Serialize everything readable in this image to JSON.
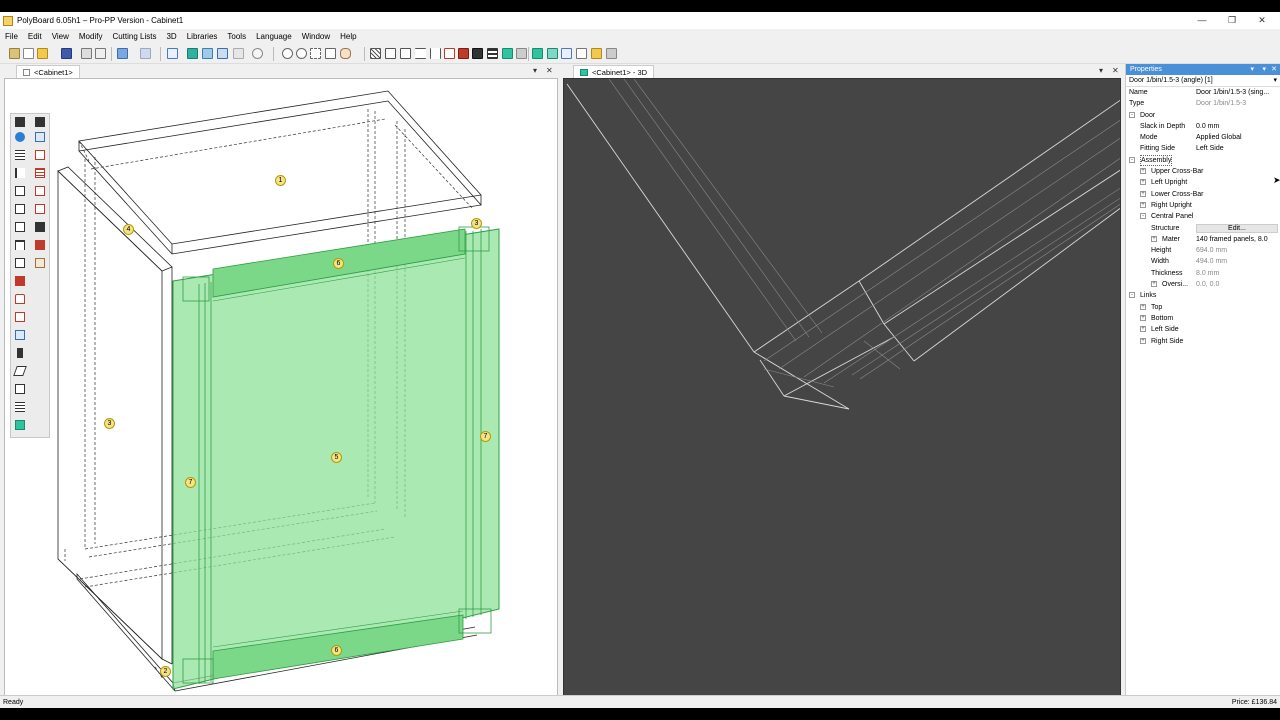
{
  "window": {
    "title": "PolyBoard 6.05h1 – Pro-PP Version - Cabinet1"
  },
  "menu": [
    "File",
    "Edit",
    "View",
    "Modify",
    "Cutting Lists",
    "3D",
    "Libraries",
    "Tools",
    "Language",
    "Window",
    "Help"
  ],
  "tabs": {
    "left": "<Cabinet1>",
    "right": "<Cabinet1> - 3D"
  },
  "parts": {
    "labels": [
      "1",
      "2",
      "3",
      "4",
      "5",
      "6",
      "7"
    ]
  },
  "properties": {
    "header": "Properties",
    "selected": "Door 1/bin/1.5-3 (angle) [1]",
    "rows": {
      "name_label": "Name",
      "name_value": "Door 1/bin/1.5-3 (sing...",
      "type_label": "Type",
      "type_value": "Door 1/bin/1.5-3",
      "door": "Door",
      "slack_label": "Slack in Depth",
      "slack_value": "0.0 mm",
      "mode_label": "Mode",
      "mode_value": "Applied Global",
      "fitting_label": "Fitting Side",
      "fitting_value": "Left Side",
      "assembly": "Assembly",
      "upper_cross_bar": "Upper Cross-Bar",
      "left_upright": "Left Upright",
      "lower_cross_bar": "Lower Cross-Bar",
      "right_upright": "Right Upright",
      "central_panel": "Central Panel",
      "structure_label": "Structure",
      "structure_value": "Edit...",
      "mater_label": "Mater",
      "mater_value": "140 framed panels, 8.0",
      "height_label": "Height",
      "height_value": "694.0 mm",
      "width_label": "Width",
      "width_value": "494.0 mm",
      "thickness_label": "Thickness",
      "thickness_value": "8.0 mm",
      "oversize_label": "Oversi...",
      "oversize_value": "0.0, 0.0",
      "links": "Links",
      "top": "Top",
      "bottom": "Bottom",
      "left_side": "Left Side",
      "right_side": "Right Side"
    }
  },
  "status": {
    "left": "Ready",
    "right": "Price: £136.84"
  },
  "colors": {
    "door_fill": "#8fe29a",
    "door_stroke": "#2f9e45",
    "view3d_bg": "#454545",
    "props_header": "#4a90d9"
  }
}
